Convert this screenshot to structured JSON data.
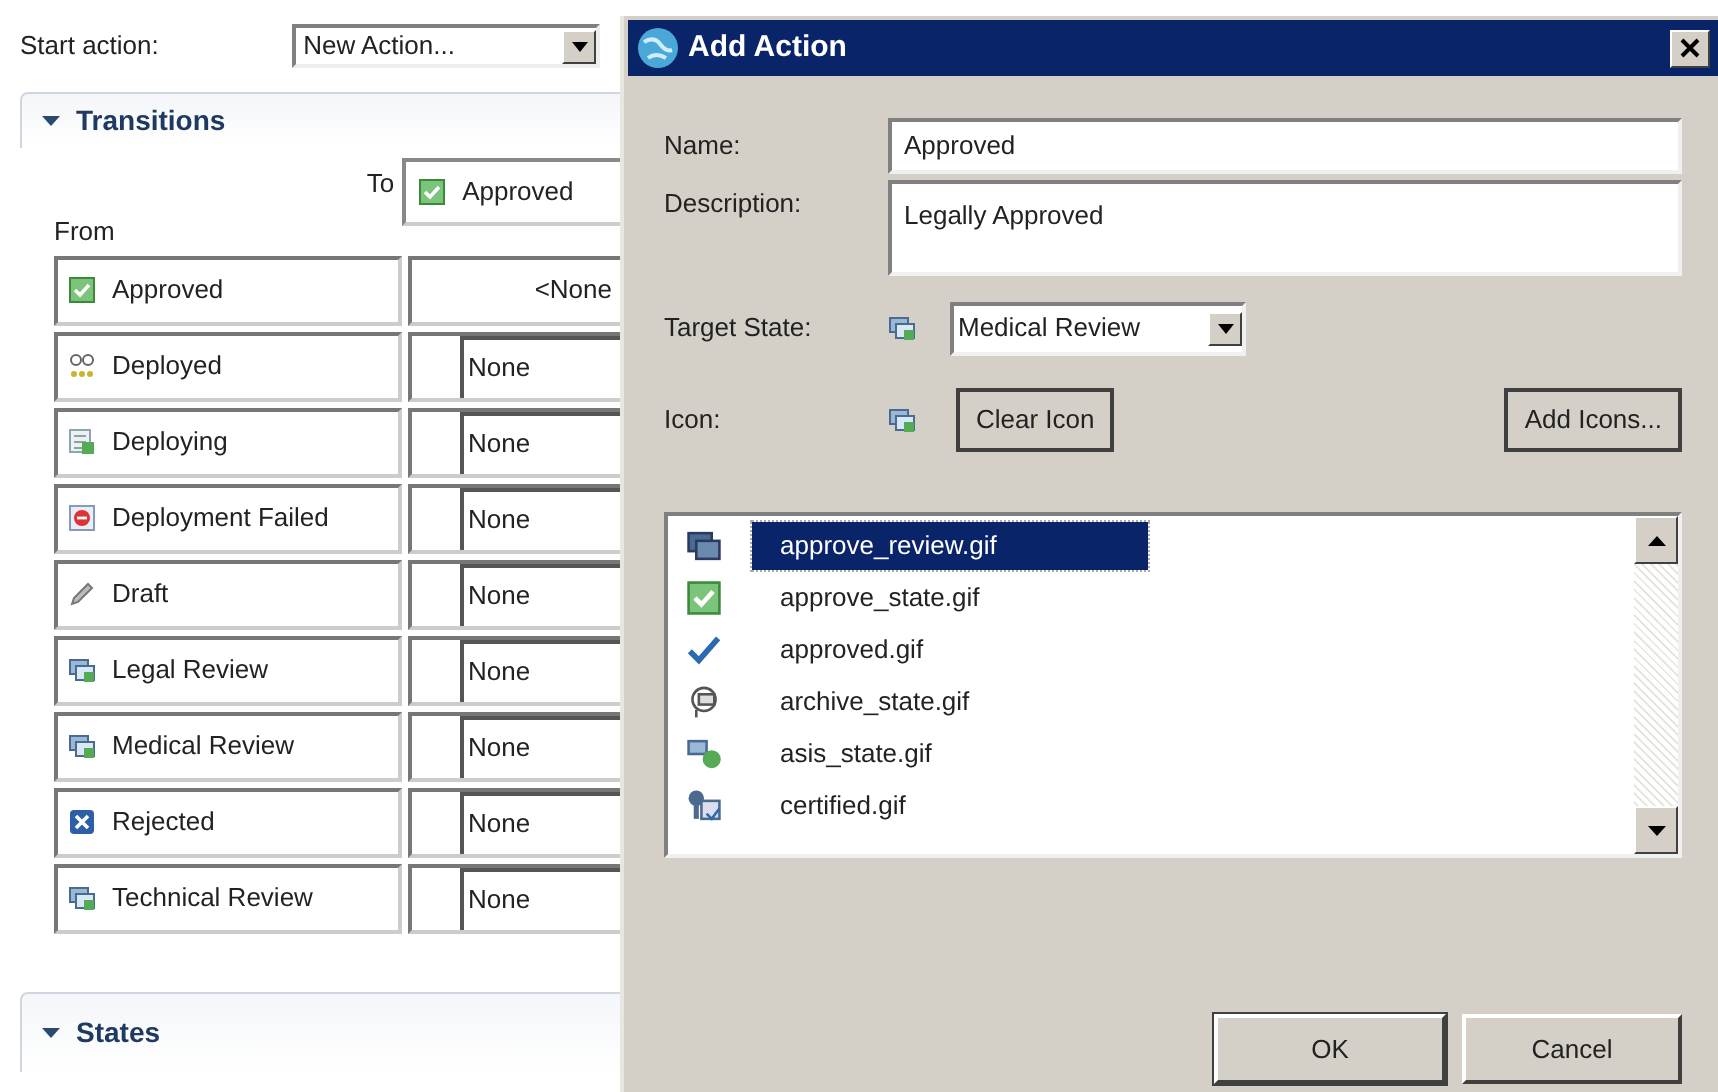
{
  "start_action": {
    "label": "Start action:",
    "value": "New Action..."
  },
  "transitions": {
    "title": "Transitions",
    "expanded": true,
    "to_label": "To",
    "from_label": "From",
    "to_column": {
      "value": "Approved",
      "kind": "approved"
    },
    "rows": [
      {
        "from": "Approved",
        "kind": "approved",
        "to": "<None",
        "editable": false
      },
      {
        "from": "Deployed",
        "kind": "deployed",
        "to": "None",
        "editable": true
      },
      {
        "from": "Deploying",
        "kind": "deploying",
        "to": "None",
        "editable": true
      },
      {
        "from": "Deployment Failed",
        "kind": "failed",
        "to": "None",
        "editable": true
      },
      {
        "from": "Draft",
        "kind": "draft",
        "to": "None",
        "editable": true
      },
      {
        "from": "Legal Review",
        "kind": "review",
        "to": "None",
        "editable": true
      },
      {
        "from": "Medical Review",
        "kind": "review",
        "to": "None",
        "editable": true
      },
      {
        "from": "Rejected",
        "kind": "rejected",
        "to": "None",
        "editable": true
      },
      {
        "from": "Technical Review",
        "kind": "review",
        "to": "None",
        "editable": true
      }
    ]
  },
  "states": {
    "title": "States",
    "expanded": true
  },
  "dialog": {
    "title": "Add Action",
    "name_label": "Name:",
    "name_value": "Approved",
    "description_label": "Description:",
    "description_value": "Legally Approved",
    "target_label": "Target State:",
    "target_value": "Medical Review",
    "icon_label": "Icon:",
    "clear_button": "Clear Icon",
    "add_icons_button": "Add Icons...",
    "icons": [
      {
        "file": "approve_review.gif",
        "kind": "review_dark",
        "selected": true
      },
      {
        "file": "approve_state.gif",
        "kind": "approved",
        "selected": false
      },
      {
        "file": "approved.gif",
        "kind": "check",
        "selected": false
      },
      {
        "file": "archive_state.gif",
        "kind": "archive",
        "selected": false
      },
      {
        "file": "asis_state.gif",
        "kind": "asis",
        "selected": false
      },
      {
        "file": "certified.gif",
        "kind": "certified",
        "selected": false
      }
    ],
    "ok_button": "OK",
    "cancel_button": "Cancel"
  }
}
